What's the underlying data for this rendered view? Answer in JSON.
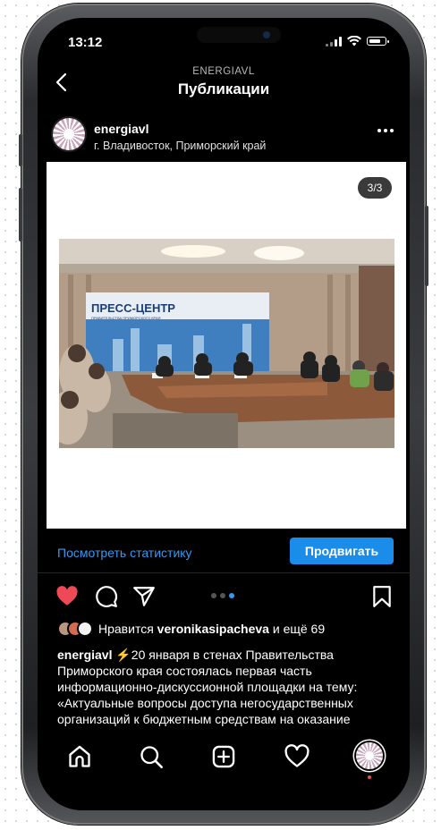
{
  "status_bar": {
    "time": "13:12"
  },
  "header": {
    "account": "ENERGIAVL",
    "title": "Публикации"
  },
  "post": {
    "username": "energiavl",
    "location": "г. Владивосток, Приморский край",
    "image_counter": "3/3",
    "image_content": {
      "banner_title": "ПРЕСС-ЦЕНТР",
      "banner_subtitle": "ПРАВИТЕЛЬСТВА ПРИМОРСКОГО КРАЯ"
    },
    "carousel": {
      "total": 3,
      "active": 3
    },
    "liked": true
  },
  "insights": {
    "link_label": "Посмотреть статистику",
    "promote_label": "Продвигать"
  },
  "likes": {
    "prefix": "Нравится",
    "user": "veronikasipacheva",
    "suffix": "и ещё 69"
  },
  "caption": {
    "username": "energiavl",
    "text": "⚡20 января в стенах Правительства Приморского края состоялась первая часть информационно-дискуссионной площадки на тему: «Актуальные вопросы доступа негосударственных организаций к бюджетным средствам на оказание социальных услуг в"
  },
  "colors": {
    "accent": "#3897f0",
    "promote": "#1a8cea",
    "like": "#ed4956"
  },
  "icons": {
    "back": "chevron-left-icon",
    "more": "more-icon",
    "like": "heart-icon",
    "comment": "comment-icon",
    "share": "send-icon",
    "save": "bookmark-icon",
    "home": "home-icon",
    "search": "search-icon",
    "new_post": "plus-square-icon",
    "activity": "heart-outline-icon"
  }
}
